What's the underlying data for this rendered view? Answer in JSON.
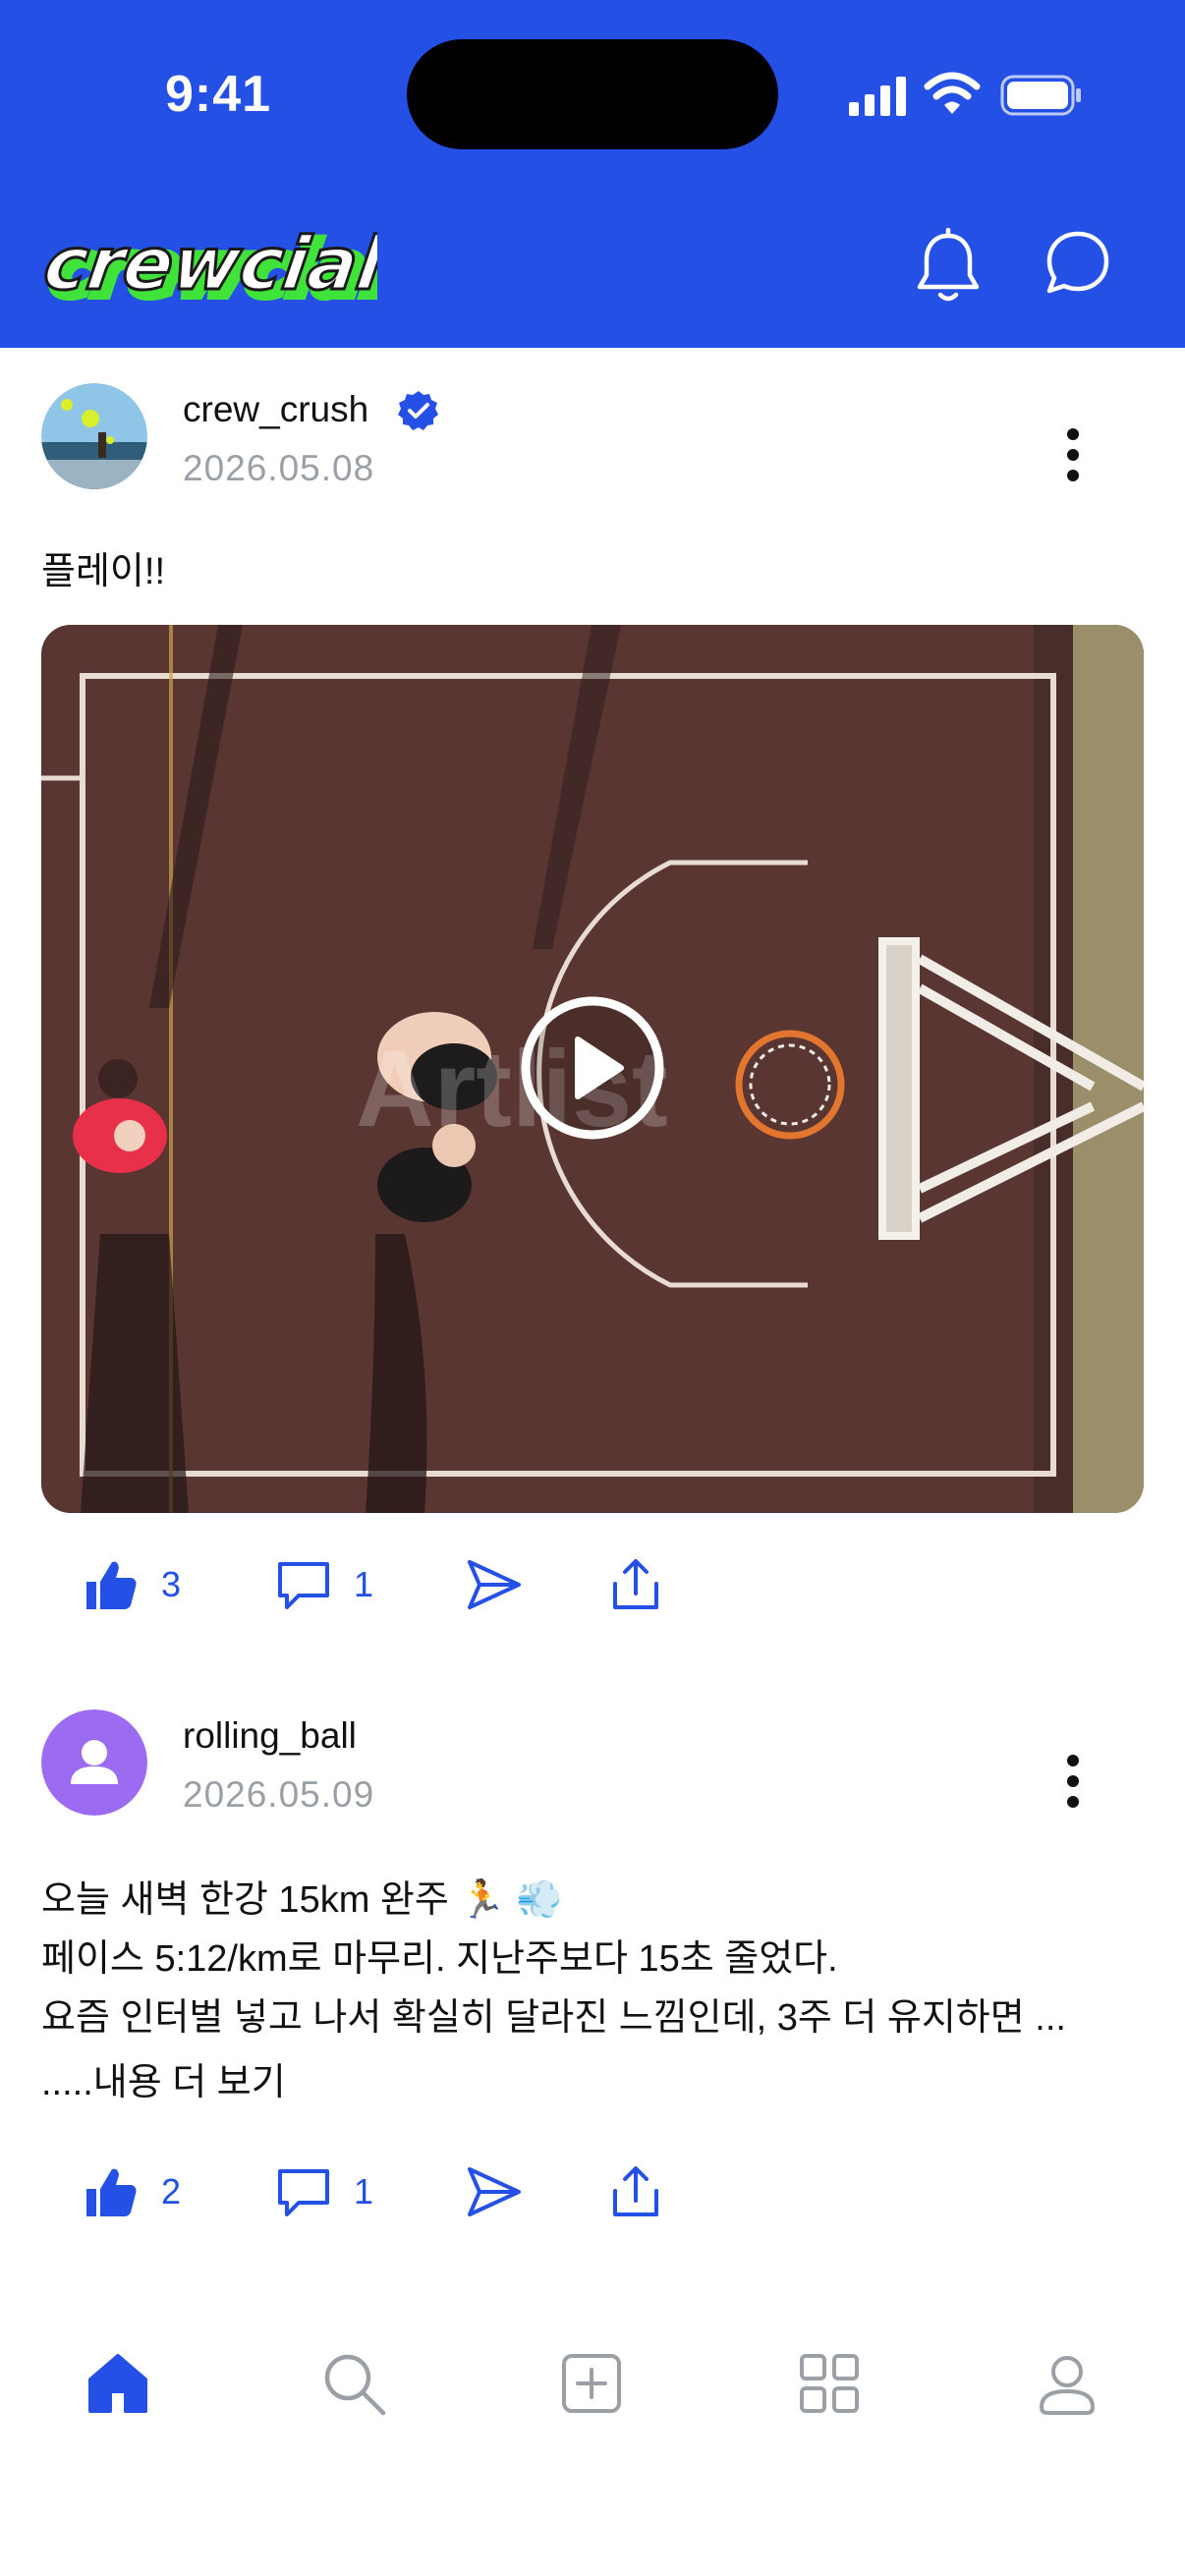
{
  "status_bar": {
    "time": "9:41"
  },
  "header": {
    "logo_text": "crewcial",
    "icons": [
      "bell-icon",
      "chat-bubble-icon"
    ]
  },
  "posts": [
    {
      "username": "crew_crush",
      "verified": true,
      "date": "2026.05.08",
      "text": "플레이!!",
      "media": {
        "type": "video",
        "watermark": "Artlist"
      },
      "likes": "3",
      "comments": "1"
    },
    {
      "username": "rolling_ball",
      "verified": false,
      "date": "2026.05.09",
      "lines": [
        "오늘 새벽 한강 15km 완주 🏃 💨",
        "페이스 5:12/km로 마무리. 지난주보다 15초 줄었다.",
        "요즘 인터벌 넣고 나서 확실히 달라진 느낌인데, 3주 더 유지하면 ..."
      ],
      "more_label": ".....내용 더 보기",
      "likes": "2",
      "comments": "1"
    }
  ],
  "bottom_nav": [
    {
      "icon": "home-icon",
      "active": true
    },
    {
      "icon": "search-icon",
      "active": false
    },
    {
      "icon": "add-post-icon",
      "active": false
    },
    {
      "icon": "grid-icon",
      "active": false
    },
    {
      "icon": "profile-icon",
      "active": false
    }
  ],
  "colors": {
    "brand": "#2550e6",
    "accent_green": "#3fe33a",
    "muted": "#9aa0a6",
    "avatar_purple": "#9b6bf2"
  }
}
